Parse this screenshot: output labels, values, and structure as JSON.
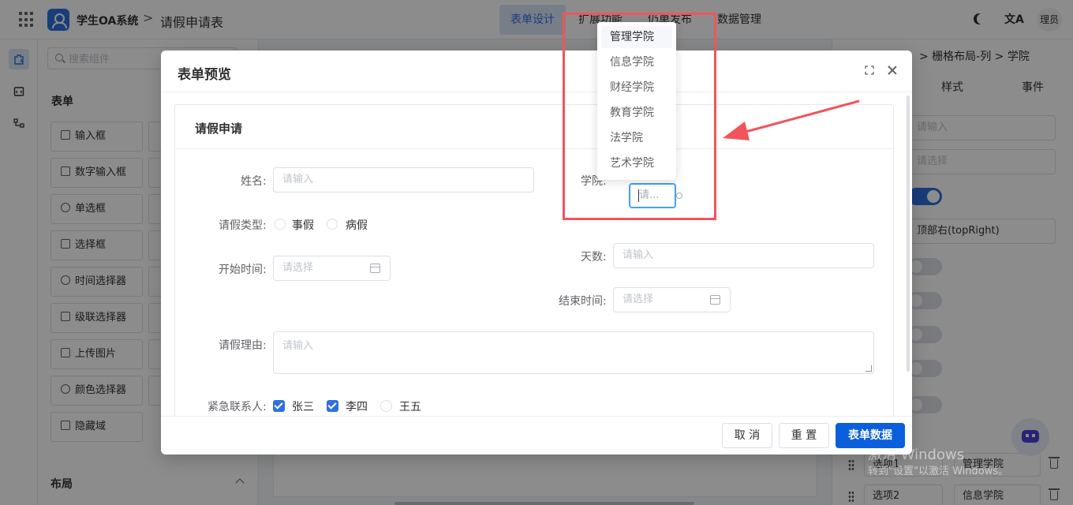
{
  "header": {
    "app_name": "学生OA系统",
    "separator": ">",
    "page_title": "请假申请表",
    "nav_tabs": [
      {
        "label": "表单设计",
        "active": true
      },
      {
        "label": "扩展功能",
        "active": false
      },
      {
        "label": "仍单发布",
        "active": false
      },
      {
        "label": "数据管理",
        "active": false
      }
    ],
    "translate_glyph": "文A",
    "user_label": "理员"
  },
  "left_panel": {
    "search_placeholder": "搜索组件",
    "section_title": "表单",
    "items": [
      "输入框",
      "数字输入框",
      "单选框",
      "选择框",
      "时间选择器",
      "级联选择器",
      "上传图片",
      "颜色选择器",
      "隐藏域"
    ],
    "layout_title": "布局"
  },
  "right_panel": {
    "breadcrumb": "> 栅格布局-列 > 学院",
    "tabs": [
      "样式",
      "事件"
    ],
    "input_placeholder": "请输入",
    "select_placeholder": "请选择",
    "position_value": "顶部右(topRight)",
    "options": [
      {
        "label": "选项1",
        "value": "管理学院"
      },
      {
        "label": "选项2",
        "value": "信息学院"
      }
    ]
  },
  "watermark": {
    "line1": "激活 Windows",
    "line2": "转到\"设置\"以激活 Windows。"
  },
  "dialog": {
    "title": "表单预览",
    "card_title": "请假申请",
    "fields": {
      "name_label": "姓名:",
      "name_placeholder": "请输入",
      "college_label": "学院:",
      "college_placeholder": "请...",
      "leave_type_label": "请假类型:",
      "leave_type_options": [
        "事假",
        "病假"
      ],
      "days_label": "天数:",
      "days_placeholder": "请输入",
      "start_label": "开始时间:",
      "start_placeholder": "请选择",
      "end_label": "结束时间:",
      "end_placeholder": "请选择",
      "reason_label": "请假理由:",
      "reason_placeholder": "请输入",
      "contact_label": "紧急联系人:",
      "contacts": [
        {
          "name": "张三",
          "checked": true
        },
        {
          "name": "李四",
          "checked": true
        },
        {
          "name": "王五",
          "checked": false
        }
      ]
    },
    "buttons": {
      "cancel": "取 消",
      "reset": "重 置",
      "data": "表单数据"
    }
  },
  "dropdown": {
    "items": [
      "管理学院",
      "信息学院",
      "财经学院",
      "教育学院",
      "法学院",
      "艺术学院"
    ],
    "hovered_index": 0
  },
  "colors": {
    "primary": "#2f6fe0",
    "annotation": "#f2545b"
  }
}
